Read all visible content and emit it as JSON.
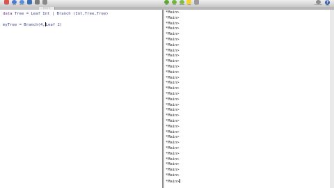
{
  "toolbar": {
    "left_buttons": [
      {
        "label": "New",
        "icon": "new-file-icon",
        "color": "#d9534f"
      },
      {
        "label": "Open",
        "icon": "open-icon",
        "color": "#4a7bd0"
      },
      {
        "label": "Revert",
        "icon": "revert-icon",
        "color": "#5a8fd6"
      },
      {
        "label": "Save",
        "icon": "save-icon",
        "color": "#3d6fb8"
      },
      {
        "label": "Print",
        "icon": "print-icon",
        "color": "#7a7a7a"
      },
      {
        "label": "Stop",
        "icon": "stop-icon",
        "color": "#8a8a8a"
      }
    ],
    "right_buttons": [
      {
        "label": "Run",
        "icon": "run-icon",
        "color": "#5aa832"
      },
      {
        "label": "Load",
        "icon": "load-icon",
        "color": "#6fb43c"
      },
      {
        "label": "Reload",
        "icon": "reload-icon",
        "color": "#7dbb4a"
      },
      {
        "label": "Copy",
        "icon": "copy-icon",
        "color": "#f2d43a"
      },
      {
        "label": "Paste",
        "icon": "paste-icon",
        "color": "#9a9a9a"
      }
    ],
    "far_right_buttons": [
      {
        "label": "Preferences",
        "icon": "gear-icon",
        "color": "#8c8c8c"
      },
      {
        "label": "Help",
        "icon": "help-icon",
        "color": "#3b5ea8"
      }
    ]
  },
  "tabs": {
    "active_label": "hastest.hs"
  },
  "editor": {
    "lines": [
      {
        "keyword": "data",
        "text": " Tree = Leaf Int | Branch (Int,Tree,Tree)"
      },
      {
        "keyword": "",
        "text": ""
      },
      {
        "keyword": "",
        "text": "myTree = Branch(4,",
        "after_cursor": "Leaf 2)"
      }
    ]
  },
  "console": {
    "prompt": "*Main>",
    "prompt_count": 32
  }
}
